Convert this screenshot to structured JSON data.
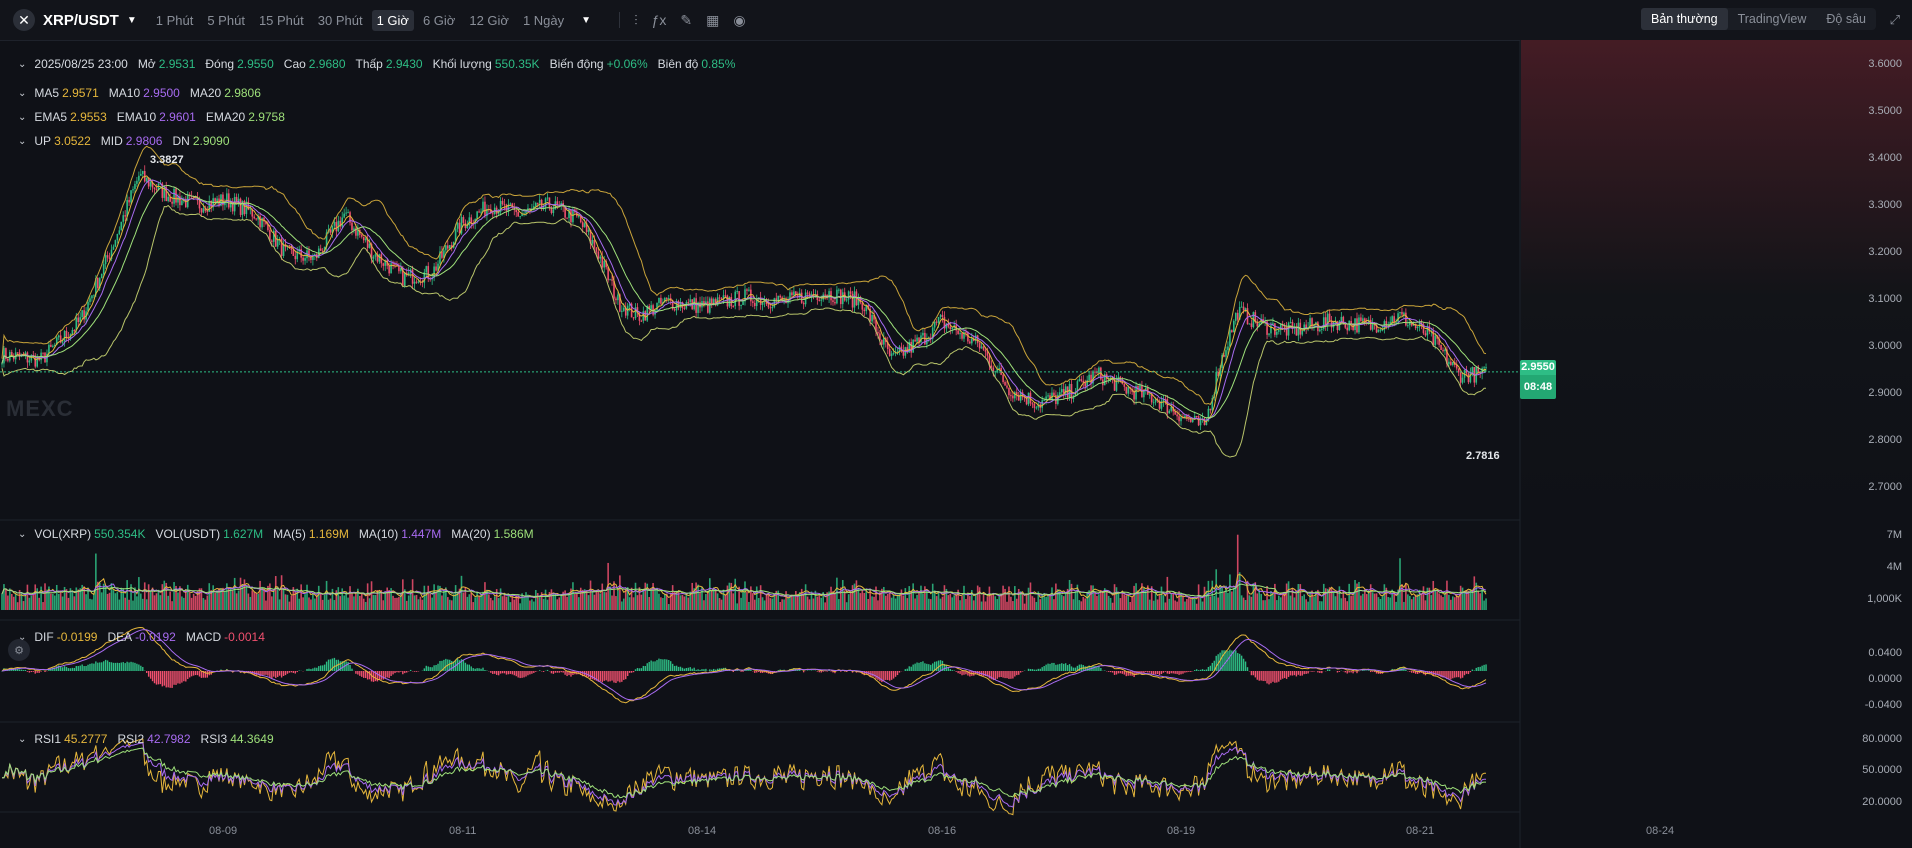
{
  "header": {
    "pair": "XRP/USDT",
    "timeframes": [
      "1 Phút",
      "5 Phút",
      "15 Phút",
      "30 Phút",
      "1 Giờ",
      "6 Giờ",
      "12 Giờ",
      "1 Ngày"
    ],
    "active_timeframe": "1 Giờ",
    "view_tabs": [
      "Bản thường",
      "TradingView",
      "Độ sâu"
    ],
    "active_view": "Bản thường",
    "tool_icons": [
      "candle-type-icon",
      "indicator-fx-icon",
      "draw-pencil-icon",
      "layout-grid-icon",
      "camera-icon"
    ]
  },
  "ohlc": {
    "date": "2025/08/25 23:00",
    "open_label": "Mở",
    "open": "2.9531",
    "close_label": "Đóng",
    "close": "2.9550",
    "high_label": "Cao",
    "high": "2.9680",
    "low_label": "Thấp",
    "low": "2.9430",
    "volume_label": "Khối lượng",
    "volume": "550.35K",
    "change_label": "Biến động",
    "change": "+0.06%",
    "amplitude_label": "Biên độ",
    "amplitude": "0.85%"
  },
  "ma": {
    "ma5_label": "MA5",
    "ma5": "2.9571",
    "ma10_label": "MA10",
    "ma10": "2.9500",
    "ma20_label": "MA20",
    "ma20": "2.9806"
  },
  "ema": {
    "ema5_label": "EMA5",
    "ema5": "2.9553",
    "ema10_label": "EMA10",
    "ema10": "2.9601",
    "ema20_label": "EMA20",
    "ema20": "2.9758"
  },
  "boll": {
    "up_label": "UP",
    "up": "3.0522",
    "mid_label": "MID",
    "mid": "2.9806",
    "dn_label": "DN",
    "dn": "2.9090"
  },
  "volume": {
    "vol_xrp_label": "VOL(XRP)",
    "vol_xrp": "550.354K",
    "vol_usdt_label": "VOL(USDT)",
    "vol_usdt": "1.627M",
    "ma5_label": "MA(5)",
    "ma5": "1.169M",
    "ma10_label": "MA(10)",
    "ma10": "1.447M",
    "ma20_label": "MA(20)",
    "ma20": "1.586M"
  },
  "macd": {
    "dif_label": "DIF",
    "dif": "-0.0199",
    "dea_label": "DEA",
    "dea": "-0.0192",
    "macd_label": "MACD",
    "macd": "-0.0014"
  },
  "rsi": {
    "rsi1_label": "RSI1",
    "rsi1": "45.2777",
    "rsi2_label": "RSI2",
    "rsi2": "42.7982",
    "rsi3_label": "RSI3",
    "rsi3": "44.3649"
  },
  "price_axis": [
    "3.6000",
    "3.5000",
    "3.4000",
    "3.3000",
    "3.2000",
    "3.1000",
    "3.0000",
    "2.9000",
    "2.8000",
    "2.7000"
  ],
  "volume_axis": [
    "7M",
    "4M",
    "1,000K"
  ],
  "macd_axis": [
    "0.0400",
    "0.0000",
    "-0.0400"
  ],
  "rsi_axis": [
    "80.0000",
    "50.0000",
    "20.0000"
  ],
  "current_price": "2.9550",
  "countdown": "08:48",
  "high_marker": "3.3827",
  "low_marker": "2.7816",
  "dates": [
    "08-09",
    "08-11",
    "08-14",
    "08-16",
    "08-19",
    "08-21",
    "08-24"
  ],
  "watermark": "MEXC",
  "colors": {
    "up": "#2ebd85",
    "down": "#f0506e",
    "ma5": "#e6b73c",
    "ma10": "#a76bf0",
    "ma20": "#9ee07a",
    "background": "#0f1117"
  },
  "chart_data": {
    "type": "candlestick",
    "title": "XRP/USDT 1 Giờ",
    "ylim": [
      2.68,
      3.62
    ],
    "close_anchors": [
      [
        0,
        2.99
      ],
      [
        20,
        2.98
      ],
      [
        40,
        3.06
      ],
      [
        55,
        3.2
      ],
      [
        70,
        3.36
      ],
      [
        85,
        3.32
      ],
      [
        100,
        3.3
      ],
      [
        115,
        3.31
      ],
      [
        130,
        3.28
      ],
      [
        145,
        3.2
      ],
      [
        160,
        3.19
      ],
      [
        175,
        3.28
      ],
      [
        190,
        3.2
      ],
      [
        205,
        3.15
      ],
      [
        220,
        3.16
      ],
      [
        235,
        3.26
      ],
      [
        250,
        3.3
      ],
      [
        265,
        3.28
      ],
      [
        280,
        3.3
      ],
      [
        295,
        3.27
      ],
      [
        305,
        3.2
      ],
      [
        315,
        3.1
      ],
      [
        325,
        3.07
      ],
      [
        340,
        3.1
      ],
      [
        360,
        3.09
      ],
      [
        380,
        3.11
      ],
      [
        400,
        3.1
      ],
      [
        420,
        3.12
      ],
      [
        440,
        3.1
      ],
      [
        455,
        2.98
      ],
      [
        470,
        3.02
      ],
      [
        480,
        3.06
      ],
      [
        500,
        3.01
      ],
      [
        515,
        2.92
      ],
      [
        530,
        2.89
      ],
      [
        545,
        2.91
      ],
      [
        560,
        2.95
      ],
      [
        575,
        2.92
      ],
      [
        590,
        2.9
      ],
      [
        605,
        2.86
      ],
      [
        615,
        2.84
      ],
      [
        622,
        2.96
      ],
      [
        632,
        3.08
      ],
      [
        645,
        3.05
      ],
      [
        660,
        3.04
      ],
      [
        680,
        3.06
      ],
      [
        700,
        3.05
      ],
      [
        715,
        3.07
      ],
      [
        730,
        3.03
      ],
      [
        745,
        2.95
      ],
      [
        760,
        2.95
      ]
    ],
    "volume_spikes": [
      [
        48,
        6.0
      ],
      [
        70,
        3.5
      ],
      [
        310,
        5.0
      ],
      [
        632,
        8.0
      ],
      [
        715,
        5.5
      ]
    ],
    "x_ticks": [
      "08-09",
      "08-11",
      "08-14",
      "08-16",
      "08-19",
      "08-21",
      "08-24"
    ]
  }
}
